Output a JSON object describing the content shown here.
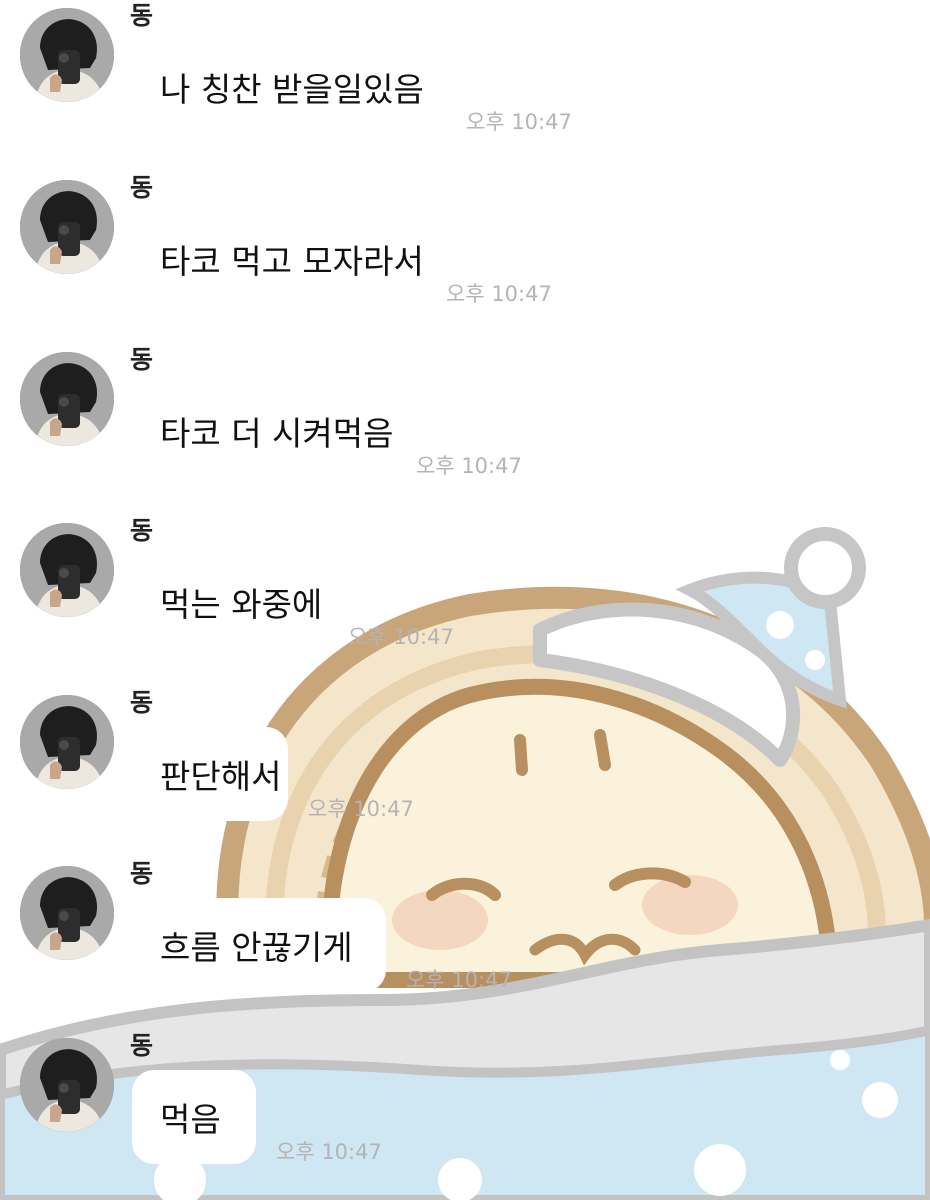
{
  "chat": {
    "messages": [
      {
        "sender": "동",
        "text": "나 칭찬 받을일있음",
        "time": "오후 10:47"
      },
      {
        "sender": "동",
        "text": "타코 먹고 모자라서",
        "time": "오후 10:47"
      },
      {
        "sender": "동",
        "text": "타코 더 시켜먹음",
        "time": "오후 10:47"
      },
      {
        "sender": "동",
        "text": "먹는 와중에",
        "time": "오후 10:47"
      },
      {
        "sender": "동",
        "text": "판단해서",
        "time": "오후 10:47"
      },
      {
        "sender": "동",
        "text": "흐름 안끊기게",
        "time": "오후 10:47"
      },
      {
        "sender": "동",
        "text": "먹음",
        "time": "오후 10:47"
      }
    ]
  },
  "colors": {
    "bubble": "#ffffff",
    "timestamp": "#b4b4b4",
    "wallpaper_blanket": "#cfe6f3",
    "wallpaper_bun": "#fbf2dc",
    "wallpaper_outline": "#b88f5e"
  }
}
